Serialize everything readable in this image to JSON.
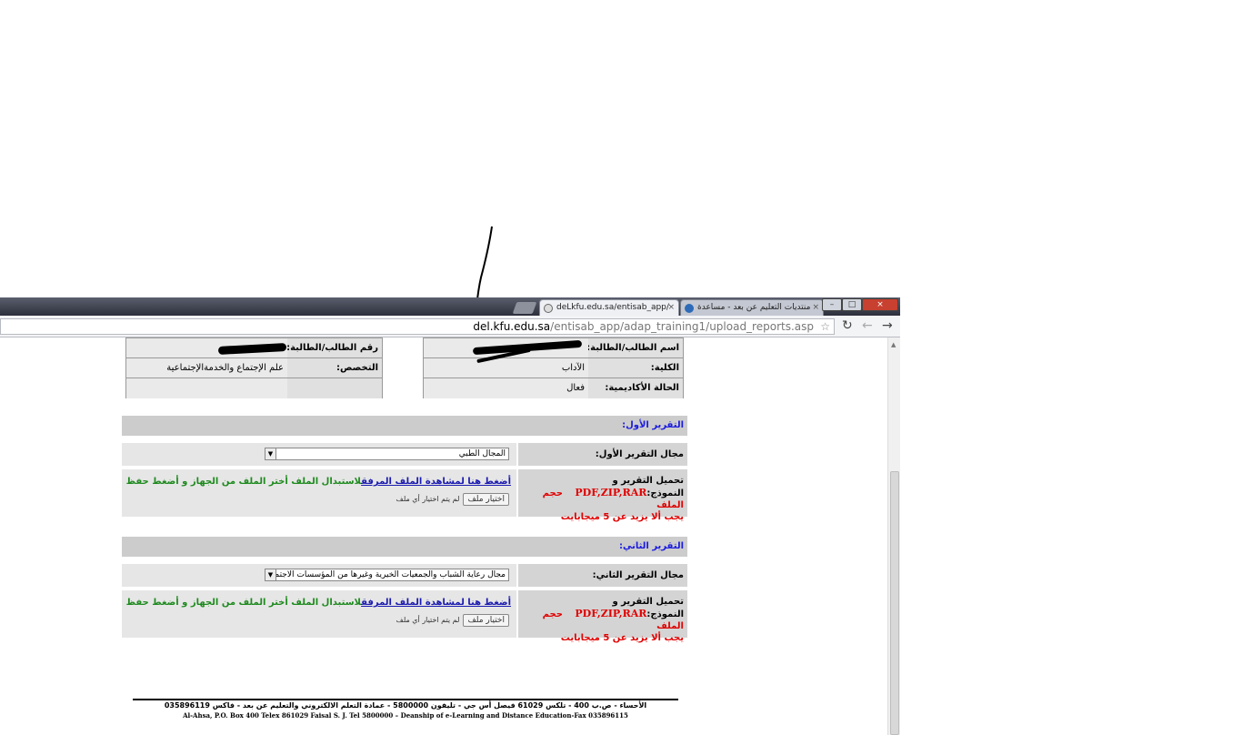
{
  "browser": {
    "tabs": [
      {
        "title": "deLkfu.edu.sa/entisab_app/",
        "active": true
      },
      {
        "title": "منتديات التعليم عن بعد - مساعدة",
        "active": false
      }
    ],
    "url_host": "del.kfu.edu.sa",
    "url_path": "/entisab_app/adap_training1/upload_reports.asp",
    "close_glyph": "×",
    "win_min": "–",
    "win_max": "□",
    "win_close": "×",
    "reload_glyph": "↻",
    "back_glyph": "←",
    "forward_glyph": "→",
    "star_glyph": "☆"
  },
  "student_info": {
    "name_label": "اسم الطالب/الطالبة:",
    "id_label": "رقم الطالب/الطالبة:",
    "college_label": "الكلية:",
    "college_value": "الآداب",
    "major_label": "التخصص:",
    "major_value": "علم الإجتماع والخدمةالإجتماعية",
    "status_label": "الحالة الأكاديمية:",
    "status_value": "فعال"
  },
  "report1": {
    "header": "التقرير الأول:",
    "field_label": "مجال التقرير الأول:",
    "field_value": "المجال الطبي",
    "upload_label_1": "تحميل التقرير و",
    "upload_label_2": "النموذج:",
    "formats": "PDF,ZIP,RAR",
    "size_label": "حجم الملف",
    "size_limit": "يجب ألا يزيد عن 5 ميجابايت",
    "view_link": "أضغط هنا لمشاهدة الملف المرفق",
    "instruction": "لاستبدال الملف أختر الملف من الجهاز و أضغط حفظ",
    "choose_button": "اختيار ملف",
    "no_file": "لم يتم اختيار أي ملف"
  },
  "report2": {
    "header": "التقرير الثاني:",
    "field_label": "مجال التقرير الثاني:",
    "field_value": "مجال رعاية الشباب والجمعيات الخيرية وغيرها من المؤسسات الاجتماعية",
    "upload_label_1": "تحميل التقرير و",
    "upload_label_2": "النموذج:",
    "formats": "PDF,ZIP,RAR",
    "size_label": "حجم الملف",
    "size_limit": "يجب ألا يزيد عن 5 ميجابايت",
    "view_link": "أضغط هنا لمشاهدة الملف المرفق",
    "instruction": "لاستبدال الملف أختر الملف من الجهاز و أضغط حفظ",
    "choose_button": "اختيار ملف",
    "no_file": "لم يتم اختيار أي ملف"
  },
  "footer": {
    "arabic": "الأحساء - ص.ب 400 - تلكس 61029 فيصل أس جي - تليفون 5800000 - عمادة التعلم الالكتروني والتعليم عن بعد - فاكس 035896119",
    "english": "Al-Ahsa, P.O. Box 400 Telex 861029 Faisal S. J. Tel 5800000 – Deanship of e-Learning and Distance Education-Fax 035896115"
  }
}
